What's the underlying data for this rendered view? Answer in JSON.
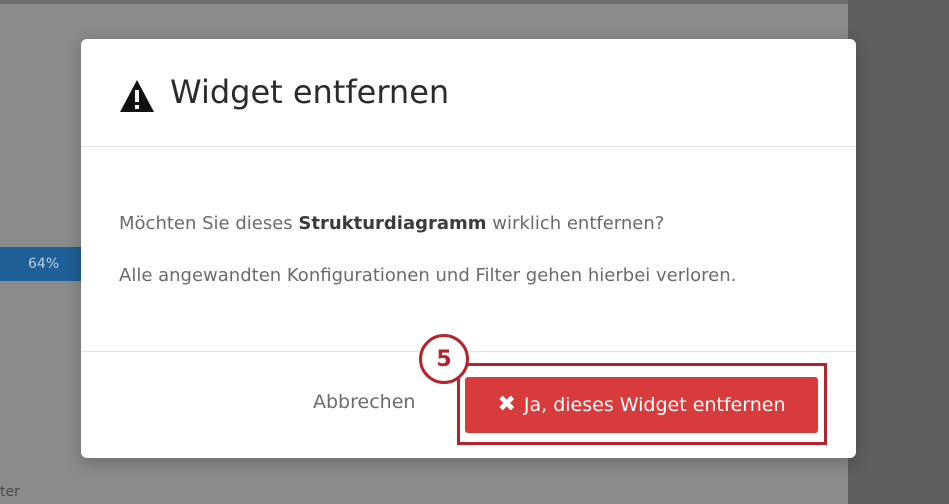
{
  "background": {
    "progress_label": "64%",
    "progress_value": 0.64,
    "bottom_fragment": "ter"
  },
  "dialog": {
    "title": "Widget entfernen",
    "title_icon": "warning-triangle-icon",
    "body": {
      "line1_prefix": "Möchten Sie dieses ",
      "line1_bold": "Strukturdiagramm",
      "line1_suffix": " wirklich entfernen?",
      "line2": "Alle angewandten Konfigurationen und Filter gehen hierbei verloren."
    },
    "footer": {
      "cancel_label": "Abbrechen",
      "confirm_label": "Ja, dieses Widget entfernen",
      "confirm_icon": "close-x-icon"
    }
  },
  "annotation": {
    "step_number": "5",
    "highlight_color": "#b5232c"
  },
  "colors": {
    "danger": "#d73b3b",
    "overlay": "#8b8b8b",
    "accent_bar": "#1f5f97"
  }
}
